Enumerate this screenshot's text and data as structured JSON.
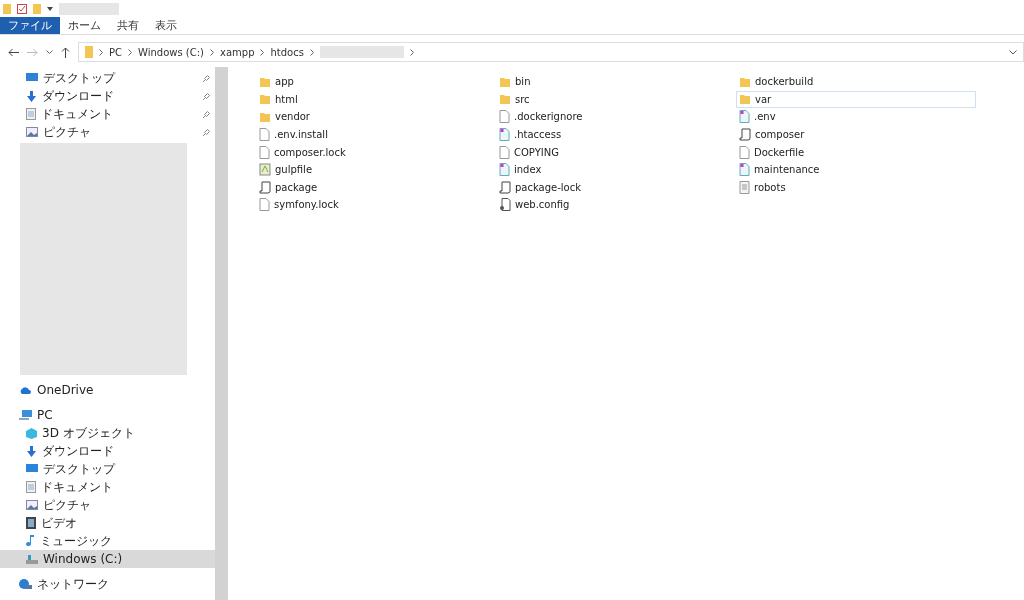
{
  "ribbon": {
    "tabs": [
      {
        "label": "ファイル",
        "selected": true
      },
      {
        "label": "ホーム",
        "selected": false
      },
      {
        "label": "共有",
        "selected": false
      },
      {
        "label": "表示",
        "selected": false
      }
    ]
  },
  "address": {
    "crumbs": [
      "PC",
      "Windows (C:)",
      "xampp",
      "htdocs"
    ]
  },
  "sidebar": {
    "pinned": [
      {
        "label": "デスクトップ",
        "kind": "desktop"
      },
      {
        "label": "ダウンロード",
        "kind": "download"
      },
      {
        "label": "ドキュメント",
        "kind": "document"
      },
      {
        "label": "ピクチャ",
        "kind": "picture"
      }
    ],
    "items": [
      {
        "label": "OneDrive",
        "kind": "cloud",
        "selected": false
      },
      {
        "label": "PC",
        "kind": "pc",
        "selected": false,
        "children": [
          {
            "label": "3D オブジェクト",
            "kind": "cube",
            "selected": false
          },
          {
            "label": "ダウンロード",
            "kind": "download",
            "selected": false
          },
          {
            "label": "デスクトップ",
            "kind": "desktop",
            "selected": false
          },
          {
            "label": "ドキュメント",
            "kind": "document",
            "selected": false
          },
          {
            "label": "ピクチャ",
            "kind": "picture",
            "selected": false
          },
          {
            "label": "ビデオ",
            "kind": "video",
            "selected": false
          },
          {
            "label": "ミュージック",
            "kind": "music",
            "selected": false
          },
          {
            "label": "Windows (C:)",
            "kind": "drive",
            "selected": true
          }
        ]
      },
      {
        "label": "ネットワーク",
        "kind": "network",
        "selected": false
      }
    ]
  },
  "files": [
    {
      "name": "app",
      "kind": "folder",
      "selected": false
    },
    {
      "name": "bin",
      "kind": "folder",
      "selected": false
    },
    {
      "name": "dockerbuild",
      "kind": "folder",
      "selected": false
    },
    {
      "name": "html",
      "kind": "folder",
      "selected": false
    },
    {
      "name": "src",
      "kind": "folder",
      "selected": false
    },
    {
      "name": "var",
      "kind": "folder",
      "selected": true
    },
    {
      "name": "vendor",
      "kind": "folder",
      "selected": false
    },
    {
      "name": ".dockerignore",
      "kind": "file",
      "selected": false
    },
    {
      "name": ".env",
      "kind": "web",
      "selected": false
    },
    {
      "name": ".env.install",
      "kind": "file",
      "selected": false
    },
    {
      "name": ".htaccess",
      "kind": "web",
      "selected": false
    },
    {
      "name": "composer",
      "kind": "json",
      "selected": false
    },
    {
      "name": "composer.lock",
      "kind": "file",
      "selected": false
    },
    {
      "name": "COPYING",
      "kind": "file",
      "selected": false
    },
    {
      "name": "Dockerfile",
      "kind": "file",
      "selected": false
    },
    {
      "name": "gulpfile",
      "kind": "script",
      "selected": false
    },
    {
      "name": "index",
      "kind": "web",
      "selected": false
    },
    {
      "name": "maintenance",
      "kind": "web",
      "selected": false
    },
    {
      "name": "package",
      "kind": "json",
      "selected": false
    },
    {
      "name": "package-lock",
      "kind": "json",
      "selected": false
    },
    {
      "name": "robots",
      "kind": "text",
      "selected": false
    },
    {
      "name": "symfony.lock",
      "kind": "file",
      "selected": false
    },
    {
      "name": "web.config",
      "kind": "config",
      "selected": false
    }
  ]
}
